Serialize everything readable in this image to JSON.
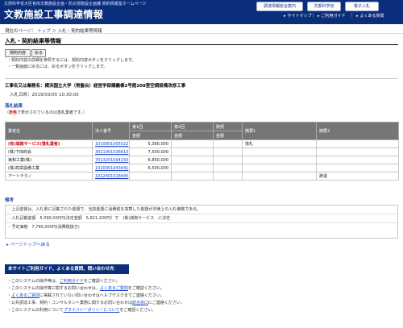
{
  "header": {
    "ministry": "文部科学省大臣官房文教施設企画・防災部施設企画課 契約情報室ホームページ",
    "title": "文教施設工事調達情報",
    "buttons": [
      "調達情報総合案内",
      "文部科学省",
      "電子入札"
    ],
    "nav": [
      "サイトマップ",
      "ご利用ガイド",
      "よくある質問"
    ]
  },
  "breadcrumb": {
    "prefix": "現在のページ：",
    "top": "トップ",
    "sep": "＞",
    "current": "入札・契約結果等情報"
  },
  "section_title": "入札・契約結果等情報",
  "buttons": {
    "contract": "契約内容",
    "back": "戻る"
  },
  "instructions": [
    "・契約内容の詳細を参照するには、契約内容ボタンをクリックします。",
    "・一覧画面に戻るには、戻るボタンをクリックします。"
  ],
  "project": {
    "name": "工事名又は業務名：横浜国立大学（常盤台）経営学部講義棟2号館208室空調設備改修工事",
    "date_label": "入札日時：",
    "date": "2019/03/05 10:30:00"
  },
  "results": {
    "heading": "落札結果",
    "note_prefix": "（",
    "note_red": "赤色",
    "note_suffix": "で表示されているのは落札業者です。）",
    "headers": [
      "業者名",
      "法人番号",
      "第1回",
      "第2回",
      "随契",
      "摘要1",
      "摘要2"
    ],
    "sub_headers": [
      "金額",
      "金額",
      "金額"
    ],
    "rows": [
      {
        "name": "(有)城南サービス(落札業者)",
        "corp": "1010801005022",
        "r1": "5,390,000",
        "r2": "",
        "z": "",
        "t1": "落札",
        "t2": "",
        "winner": true
      },
      {
        "name": "(株)下田商会",
        "corp": "3021001036613",
        "r1": "7,500,000",
        "r2": "",
        "z": "",
        "t1": "",
        "t2": "",
        "winner": false
      },
      {
        "name": "東和工業(株)",
        "corp": "7013201004150",
        "r1": "6,850,000",
        "r2": "",
        "z": "",
        "t1": "",
        "t2": "",
        "winner": false
      },
      {
        "name": "(株)高栄設備工業",
        "corp": "1020001043441",
        "r1": "6,500,000",
        "r2": "",
        "z": "",
        "t1": "",
        "t2": "",
        "winner": false
      },
      {
        "name": "アートテクノ",
        "corp": "1012401018445",
        "r1": "",
        "r2": "",
        "z": "",
        "t1": "",
        "t2": "辞退",
        "winner": false
      }
    ]
  },
  "remarks": {
    "heading": "備考",
    "lines": [
      "- 上記金額は、入札書に記載された金額で、当該金額に消費税を加算した金額が法律上の入札価格である。",
      "- 入札記載金額　5,390,000円(決定金額　5,821,200円）で　(株)城南サービス　に決定",
      "- 予定価格　7,790,000円(消費税抜き)"
    ]
  },
  "pagetop": "ページトップへ戻る",
  "footer": {
    "bar": "本サイトご利用ガイド、よくある質問、問い合わせ先",
    "lines": [
      {
        "pre": "・このシステムの操作等は、",
        "link": "ご利用ガイド",
        "post": "をご確認ください。"
      },
      {
        "pre": "・このシステムの操作等に関するお問い合わせは、",
        "link": "よくあるご質問",
        "post": "をご確認ください。"
      },
      {
        "pre": "・",
        "link": "よくあるご質問",
        "post": "に掲載されていない問い合わせはヘルプデスクまでご連絡ください。"
      },
      {
        "pre": "・公共調達工事、契約・コンサルタント業務に関するお問い合わせは",
        "link": "総合窓口",
        "post": "にご連絡ください。"
      },
      {
        "pre": "・このシステムの利用について",
        "link": "プライバシーポリシーについて",
        "post": "をご確認ください。"
      }
    ]
  }
}
